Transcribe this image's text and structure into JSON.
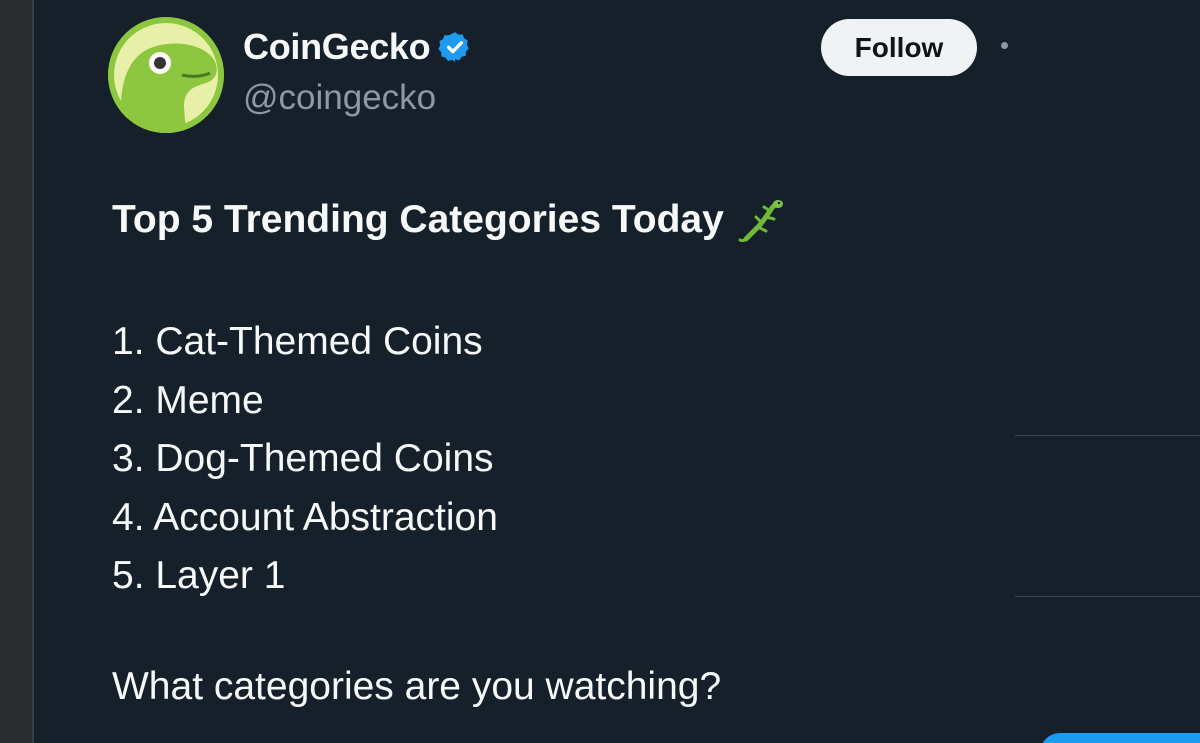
{
  "author": {
    "display_name": "CoinGecko",
    "handle": "@coingecko",
    "verified": true,
    "avatar_icon": "coingecko-logo-icon",
    "verified_icon": "verified-badge-icon"
  },
  "actions": {
    "follow_label": "Follow",
    "more_icon": "more-options-icon"
  },
  "tweet": {
    "title": "Top 5 Trending Categories Today",
    "title_emoji": "lizard-emoji",
    "items": [
      "1. Cat-Themed Coins",
      "2. Meme",
      "3. Dog-Themed Coins",
      "4. Account Abstraction",
      "5. Layer 1"
    ],
    "question": "What categories are you watching?"
  },
  "colors": {
    "background": "#15202b",
    "text_primary": "#f7f9f9",
    "text_secondary": "#8b98a5",
    "verified_blue": "#1d9bf0",
    "follow_button_bg": "#eff3f4",
    "brand_green": "#8dc63f"
  }
}
